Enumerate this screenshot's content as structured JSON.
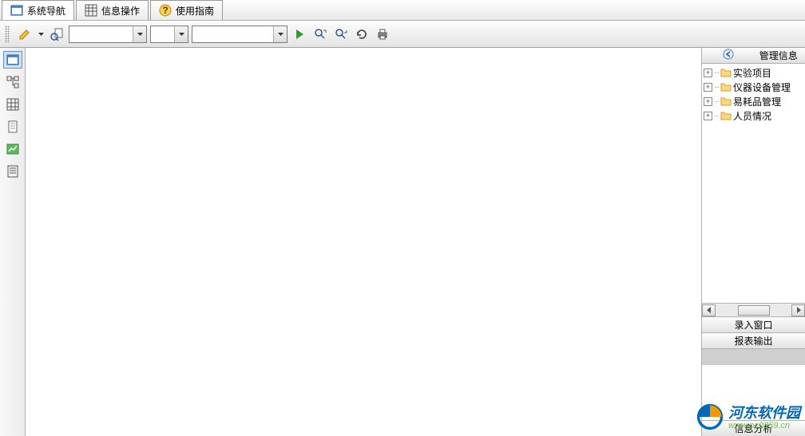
{
  "tabs": [
    {
      "label": "系统导航"
    },
    {
      "label": "信息操作"
    },
    {
      "label": "使用指南"
    }
  ],
  "toolbar": {
    "combo1": "",
    "combo2": "",
    "combo3": ""
  },
  "right_panel": {
    "title": "管理信息",
    "tree": [
      {
        "label": "实验项目"
      },
      {
        "label": "仪器设备管理"
      },
      {
        "label": "易耗品管理"
      },
      {
        "label": "人员情况"
      }
    ],
    "accordion": [
      "录入窗口",
      "报表输出",
      "",
      "信息分析"
    ]
  },
  "watermark": {
    "name": "河东软件园",
    "url": "www.pc0359.cn"
  }
}
